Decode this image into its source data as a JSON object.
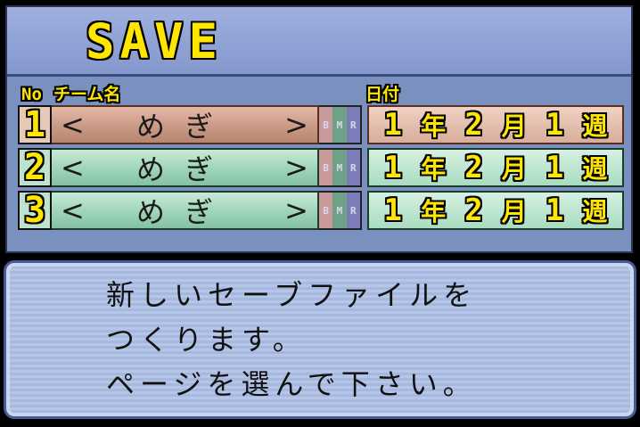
{
  "header": {
    "title": "SAVE"
  },
  "columns": {
    "no": "No",
    "team": "チーム名",
    "date": "日付"
  },
  "slots": [
    {
      "no": "1",
      "team_open": "<",
      "team_name": "めぎ",
      "team_close": ">",
      "b": "B",
      "m": "M",
      "r": "R",
      "year": "1",
      "year_unit": "年",
      "month": "2",
      "month_unit": "月",
      "week": "1",
      "week_unit": "週"
    },
    {
      "no": "2",
      "team_open": "<",
      "team_name": "めぎ",
      "team_close": ">",
      "b": "B",
      "m": "M",
      "r": "R",
      "year": "1",
      "year_unit": "年",
      "month": "2",
      "month_unit": "月",
      "week": "1",
      "week_unit": "週"
    },
    {
      "no": "3",
      "team_open": "<",
      "team_name": "めぎ",
      "team_close": ">",
      "b": "B",
      "m": "M",
      "r": "R",
      "year": "1",
      "year_unit": "年",
      "month": "2",
      "month_unit": "月",
      "week": "1",
      "week_unit": "週"
    }
  ],
  "message": {
    "line1": "新しいセーブファイルを",
    "line2": "つくります。",
    "line3": "ページを選んで下さい。"
  },
  "colors": {
    "accent_text": "#ffe600",
    "selected_row": "#c99a86",
    "row": "#9ed4b8"
  }
}
